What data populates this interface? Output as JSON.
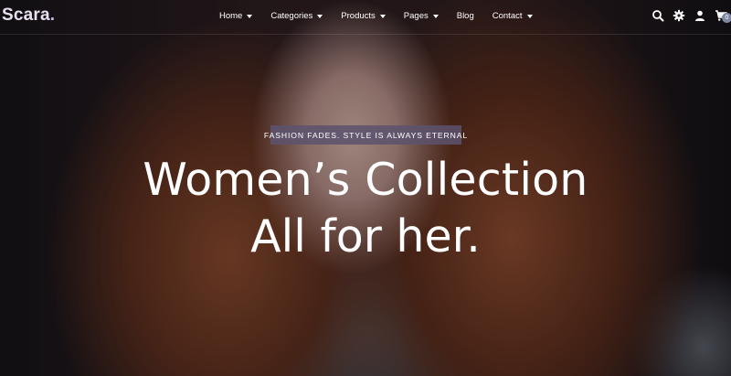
{
  "brand": {
    "name": "Scara",
    "dot": "."
  },
  "nav": {
    "items": [
      {
        "label": "Home",
        "dropdown": true
      },
      {
        "label": "Categories",
        "dropdown": true
      },
      {
        "label": "Products",
        "dropdown": true
      },
      {
        "label": "Pages",
        "dropdown": true
      },
      {
        "label": "Blog",
        "dropdown": false
      },
      {
        "label": "Contact",
        "dropdown": true
      }
    ],
    "icons": [
      "search-icon",
      "gear-icon",
      "user-icon",
      "cart-icon"
    ],
    "cart_count": "0"
  },
  "hero": {
    "tagline": "FASHION FADES. STYLE IS ALWAYS ETERNAL",
    "headline_line1": "Women’s Collection",
    "headline_line2": "All for her."
  },
  "colors": {
    "tagline_bg": "#5c526e",
    "badge": "#7d86a0",
    "text": "#ffffff"
  }
}
